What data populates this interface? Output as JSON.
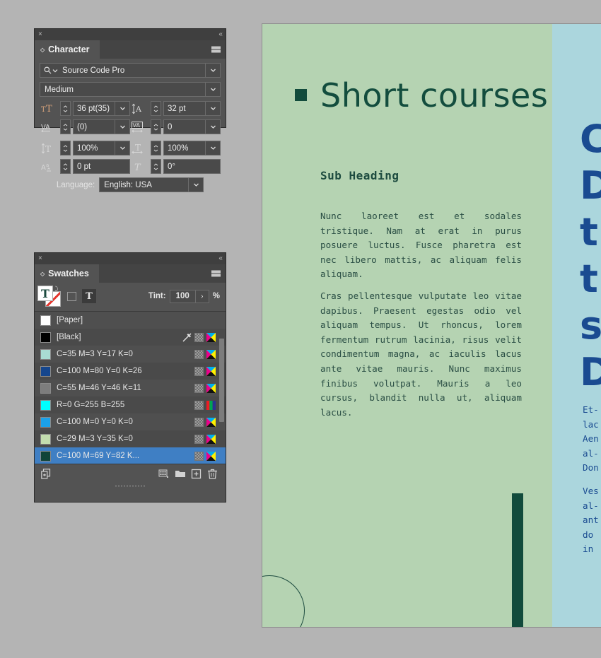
{
  "app": {
    "background_color": "#b4b4b4",
    "panel_bg": "#535353",
    "selection_color": "#3f7fc4"
  },
  "character_panel": {
    "close_icon": "×",
    "collapse_icon": "‹‹",
    "tab_label": "Character",
    "tab_diamond": "◇",
    "menu_icon": "panel-menu-icon",
    "font_family": {
      "value": "Source Code Pro",
      "search_icon": "search-icon"
    },
    "font_style": {
      "value": "Medium"
    },
    "font_size": {
      "icon": "font-size-icon",
      "value": "36 pt(35)"
    },
    "leading": {
      "icon": "leading-icon",
      "value": "32 pt"
    },
    "kerning": {
      "icon": "kerning-icon",
      "value": "(0)"
    },
    "tracking": {
      "icon": "tracking-icon",
      "value": "0"
    },
    "vertical_scale": {
      "icon": "vertical-scale-icon",
      "value": "100%"
    },
    "horizontal_scale": {
      "icon": "horizontal-scale-icon",
      "value": "100%"
    },
    "baseline_shift": {
      "icon": "baseline-shift-icon",
      "value": "0 pt"
    },
    "skew": {
      "icon": "skew-icon",
      "value": "0°"
    },
    "language": {
      "label": "Language:",
      "value": "English: USA"
    }
  },
  "swatches_panel": {
    "close_icon": "×",
    "collapse_icon": "‹‹",
    "tab_label": "Swatches",
    "tab_diamond": "◇",
    "menu_icon": "panel-menu-icon",
    "fill_glyph": "T",
    "stroke_glyph": "T",
    "formatting_text_glyph": "T",
    "tint": {
      "label": "Tint:",
      "value": "100",
      "unit": "%",
      "arrow": "›"
    },
    "swatches": [
      {
        "name": "[Paper]",
        "color": "#ffffff",
        "selected": false,
        "icons": []
      },
      {
        "name": "[Black]",
        "color": "#000000",
        "selected": false,
        "icons": [
          "no-print-icon",
          "grid-icon",
          "cmyk-icon"
        ]
      },
      {
        "name": "C=35 M=3 Y=17 K=0",
        "color": "#a9dbd2",
        "selected": false,
        "icons": [
          "grid-icon",
          "cmyk-icon"
        ]
      },
      {
        "name": "C=100 M=80 Y=0 K=26",
        "color": "#15468d",
        "selected": false,
        "icons": [
          "grid-icon",
          "cmyk-icon"
        ]
      },
      {
        "name": "C=55 M=46 Y=46 K=11",
        "color": "#7d7d7d",
        "selected": false,
        "icons": [
          "grid-icon",
          "cmyk-icon"
        ]
      },
      {
        "name": "R=0 G=255 B=255",
        "color": "#00ffff",
        "selected": false,
        "icons": [
          "grid-icon",
          "rgb-icon"
        ]
      },
      {
        "name": "C=100 M=0 Y=0 K=0",
        "color": "#1ba1e8",
        "selected": false,
        "icons": [
          "grid-icon",
          "cmyk-icon"
        ]
      },
      {
        "name": "C=29 M=3 Y=35 K=0",
        "color": "#c2dcae",
        "selected": false,
        "icons": [
          "grid-icon",
          "cmyk-icon"
        ]
      },
      {
        "name": "C=100 M=69 Y=82 K...",
        "color": "#114438",
        "selected": true,
        "icons": [
          "grid-icon",
          "cmyk-icon"
        ]
      }
    ],
    "footer_icons": [
      "add-to-cc-library-icon",
      "new-color-group-icon",
      "new-color-group-folder-icon",
      "new-swatch-icon",
      "delete-swatch-icon"
    ]
  },
  "document": {
    "page_green_color": "#b5d3b2",
    "page_blue_color": "#abd6dd",
    "heading_color": "#134d3e",
    "blue_text_color": "#1a4b91",
    "title": "Short courses",
    "subheading": "Sub Heading",
    "paragraph_1": "Nunc laoreet est et sodales tristique. Nam at erat in purus posuere luctus. Fusce pharetra est nec libero mattis, ac aliquam felis aliquam.",
    "paragraph_2": "Cras pellentesque vulputate leo vitae dapibus. Praesent egestas odio vel aliquam tempus. Ut rhoncus, lorem fermentum rutrum lacinia, risus velit condimentum magna, ac iaculis lacus ante vitae mauris. Nunc maximus finibus volutpat. Mauris a leo cursus, blandit nulla ut, aliquam lacus.",
    "blue_column_heading": "Cs\nDi\nt\nt\nsi\nDe",
    "blue_paragraph_1": "Et-\nlac\nAen\nal-\nDon",
    "blue_paragraph_2": "Ves\nal-\nant\ndo\nin"
  }
}
